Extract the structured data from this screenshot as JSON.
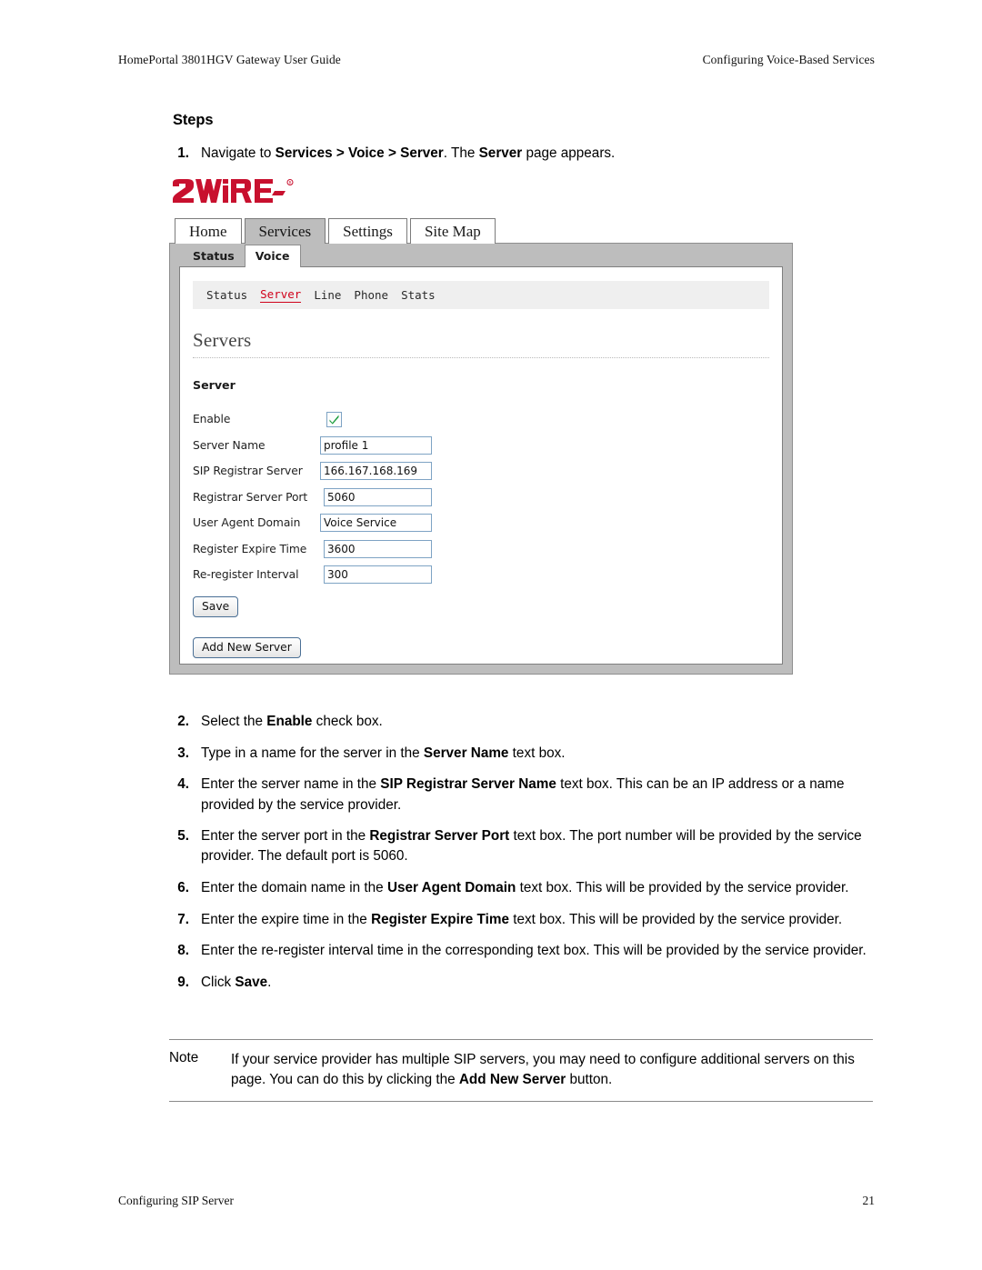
{
  "page": {
    "running_head_left": "HomePortal 3801HGV Gateway User Guide",
    "running_head_right": "Configuring Voice-Based Services",
    "running_foot_left": "Configuring SIP Server",
    "running_foot_right": "21",
    "steps_heading": "Steps"
  },
  "steps": [
    {
      "num": "1.",
      "html": "Navigate to <b>Services &gt; Voice &gt; Server</b>. The <b>Server</b> page appears."
    },
    {
      "num": "2.",
      "html": "Select the <b>Enable</b> check box."
    },
    {
      "num": "3.",
      "html": "Type in a name for the server in the <b>Server Name</b> text box."
    },
    {
      "num": "4.",
      "html": "Enter the server name in the <b>SIP Registrar Server Name</b> text box. This can be an IP address or a name provided by the service provider."
    },
    {
      "num": "5.",
      "html": "Enter the server port in the <b>Registrar Server Port</b> text box. The port number will be provided by the service provider. The default port is 5060."
    },
    {
      "num": "6.",
      "html": "Enter the domain name in the <b>User Agent Domain</b> text box. This will be provided by the service provider."
    },
    {
      "num": "7.",
      "html": "Enter the expire time in the <b>Register Expire Time</b> text box. This will be provided by the service provider."
    },
    {
      "num": "8.",
      "html": "Enter the re-register interval time in the corresponding text box. This will be provided by the service provider."
    },
    {
      "num": "9.",
      "html": "Click <b>Save</b>."
    }
  ],
  "note": {
    "label": "Note",
    "html": "If your service provider has multiple SIP servers, you may need to configure additional servers on this page. You can do this by clicking the <b>Add New Server</b> button."
  },
  "screenshot": {
    "logo_text": "2WIRE",
    "logo_trademark": "®",
    "logo_color": "#c8102e",
    "main_tabs": [
      {
        "label": "Home",
        "active": false
      },
      {
        "label": "Services",
        "active": true
      },
      {
        "label": "Settings",
        "active": false
      },
      {
        "label": "Site Map",
        "active": false
      }
    ],
    "sub_tabs": [
      {
        "label": "Status",
        "active": false
      },
      {
        "label": "Voice",
        "active": true
      }
    ],
    "subnav": [
      {
        "label": "Status",
        "active": false
      },
      {
        "label": "Server",
        "active": true
      },
      {
        "label": "Line",
        "active": false
      },
      {
        "label": "Phone",
        "active": false
      },
      {
        "label": "Stats",
        "active": false
      }
    ],
    "subnav_active_color": "#d0021b",
    "panel_title": "Servers",
    "section_label": "Server",
    "form": [
      {
        "label": "Enable",
        "type": "checkbox",
        "checked": true
      },
      {
        "label": "Server Name",
        "type": "text",
        "value": "profile 1"
      },
      {
        "label": "SIP Registrar Server",
        "type": "text",
        "value": "166.167.168.169"
      },
      {
        "label": "Registrar Server Port",
        "type": "text",
        "value": "5060"
      },
      {
        "label": "User Agent Domain",
        "type": "text",
        "value": "Voice Service"
      },
      {
        "label": "Register Expire Time",
        "type": "text",
        "value": "3600"
      },
      {
        "label": "Re-register Interval",
        "type": "text",
        "value": "300"
      }
    ],
    "save_button": "Save",
    "add_new_server_button": "Add New Server"
  }
}
